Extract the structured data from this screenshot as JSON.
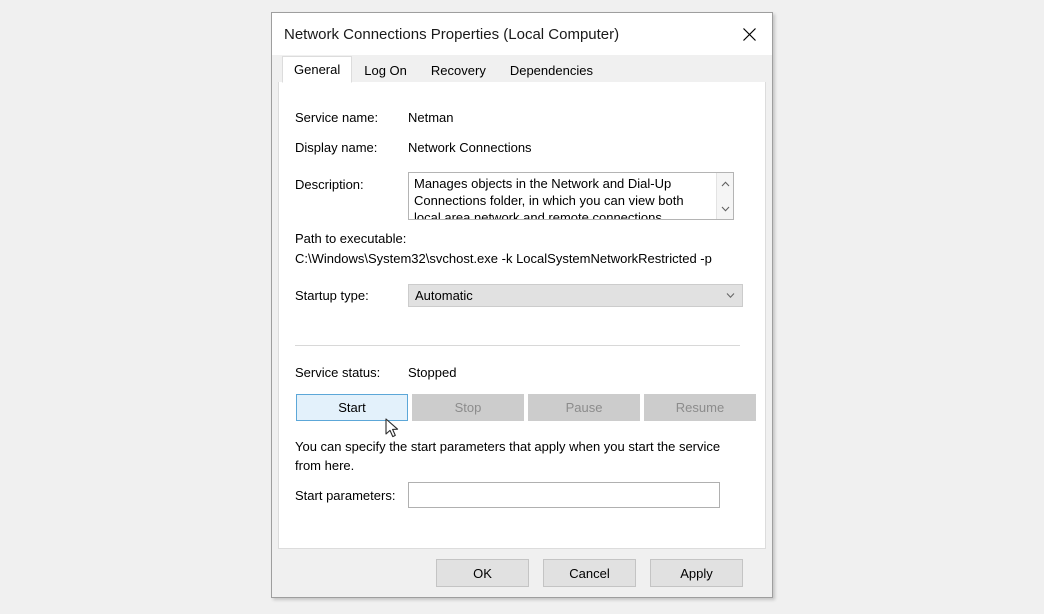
{
  "window": {
    "title": "Network Connections Properties (Local Computer)",
    "close_icon": "close-icon"
  },
  "tabs": [
    {
      "label": "General",
      "active": true
    },
    {
      "label": "Log On",
      "active": false
    },
    {
      "label": "Recovery",
      "active": false
    },
    {
      "label": "Dependencies",
      "active": false
    }
  ],
  "general": {
    "service_name_label": "Service name:",
    "service_name_value": "Netman",
    "display_name_label": "Display name:",
    "display_name_value": "Network Connections",
    "description_label": "Description:",
    "description_value": "Manages objects in the Network and Dial-Up Connections folder, in which you can view both local area network and remote connections.",
    "scroll_up_icon": "chevron-up-icon",
    "scroll_down_icon": "chevron-down-icon",
    "path_label": "Path to executable:",
    "path_value": "C:\\Windows\\System32\\svchost.exe -k LocalSystemNetworkRestricted -p",
    "startup_type_label": "Startup type:",
    "startup_type_value": "Automatic",
    "startup_type_arrow_icon": "chevron-down-icon",
    "service_status_label": "Service status:",
    "service_status_value": "Stopped",
    "hint_text": "You can specify the start parameters that apply when you start the service from here.",
    "start_parameters_label": "Start parameters:",
    "start_parameters_value": "",
    "start_parameters_placeholder": ""
  },
  "service_actions": [
    {
      "label": "Start",
      "state": "primary"
    },
    {
      "label": "Stop",
      "state": "disabled"
    },
    {
      "label": "Pause",
      "state": "disabled"
    },
    {
      "label": "Resume",
      "state": "disabled"
    }
  ],
  "footer": {
    "ok_label": "OK",
    "cancel_label": "Cancel",
    "apply_label": "Apply"
  },
  "colors": {
    "accent_border": "#5ca7d8",
    "accent_fill": "#e3f1fb",
    "disabled_fill": "#cccccc",
    "disabled_text": "#8c8c8c",
    "dialog_bg": "#f0f0f0",
    "panel_bg": "#ffffff"
  }
}
